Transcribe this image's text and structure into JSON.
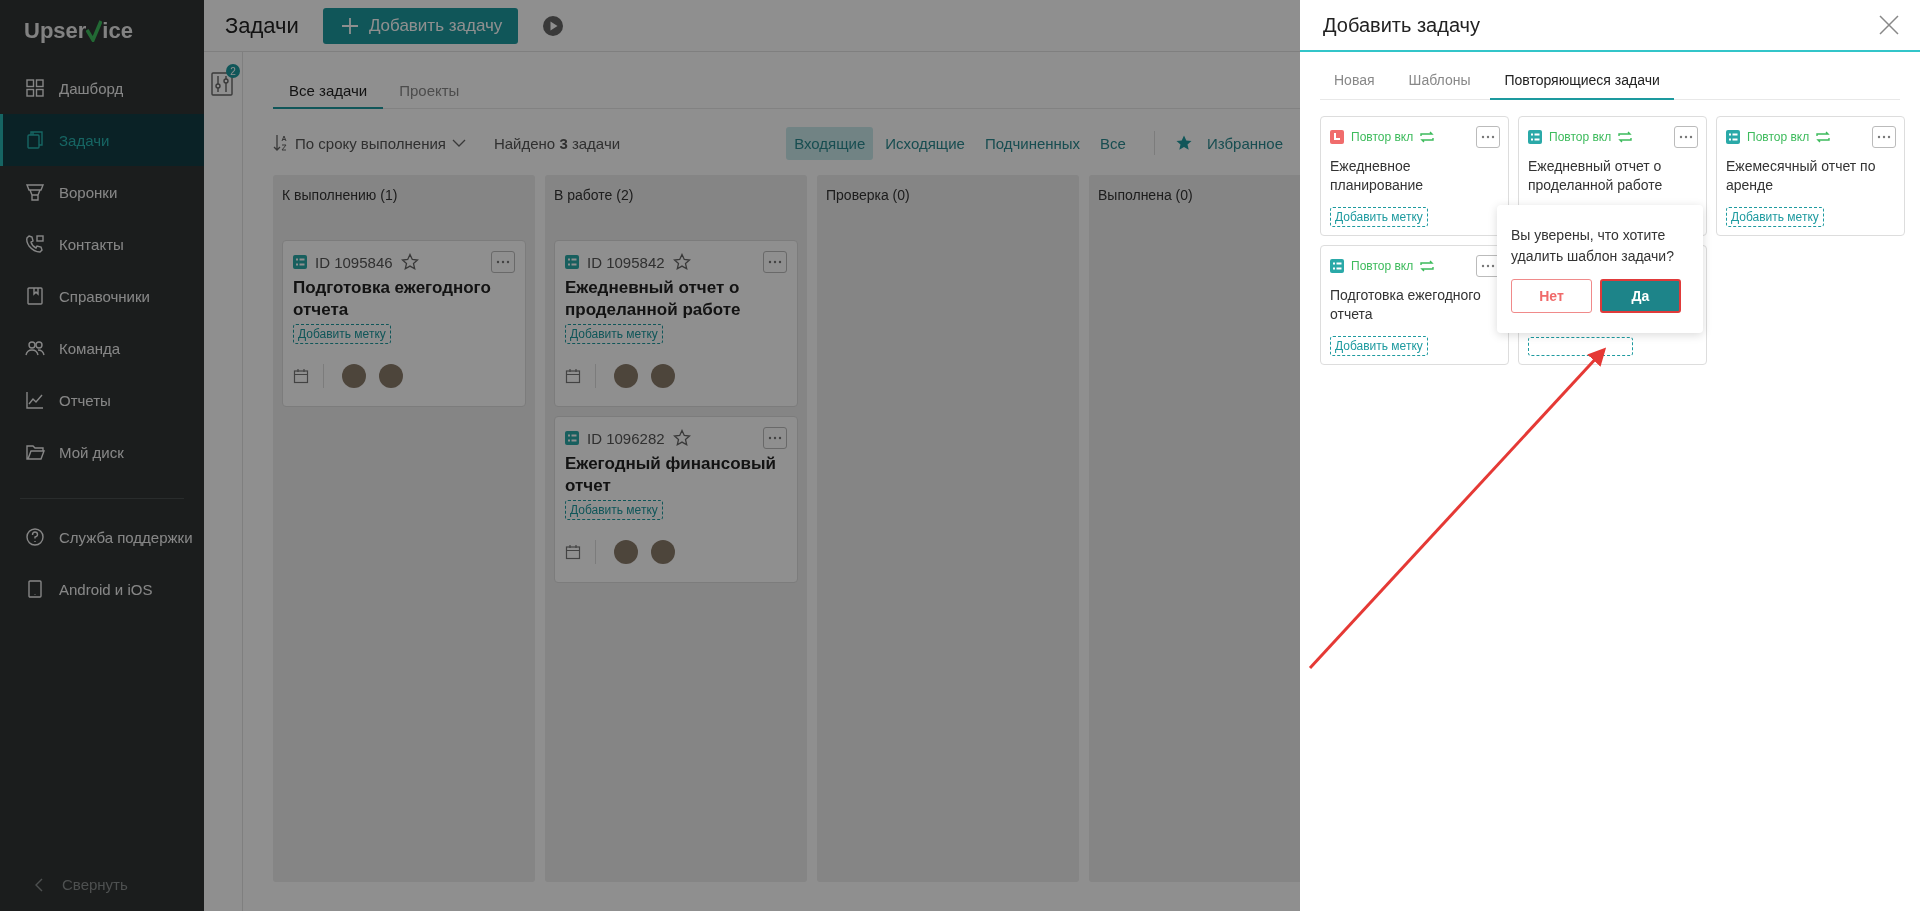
{
  "sidebar": {
    "logo": {
      "before": "Upser",
      "after": "ice"
    },
    "items": [
      {
        "label": "Дашборд",
        "selected": false
      },
      {
        "label": "Задачи",
        "selected": true
      },
      {
        "label": "Воронки",
        "selected": false
      },
      {
        "label": "Контакты",
        "selected": false
      },
      {
        "label": "Справочники",
        "selected": false
      },
      {
        "label": "Команда",
        "selected": false
      },
      {
        "label": "Отчеты",
        "selected": false
      },
      {
        "label": "Мой диск",
        "selected": false
      }
    ],
    "bottom_items": [
      {
        "label": "Служба поддержки"
      },
      {
        "label": "Android и iOS"
      }
    ],
    "collapse": "Свернуть"
  },
  "header": {
    "title": "Задачи",
    "add_button": "Добавить задачу"
  },
  "filter_badge": "2",
  "tabs": [
    {
      "label": "Все задачи",
      "selected": true
    },
    {
      "label": "Проекты",
      "selected": false
    }
  ],
  "toolbar": {
    "sort": "По сроку выполнения",
    "found": "Найдено **3** задачи",
    "filters": [
      {
        "label": "Входящие",
        "selected": true
      },
      {
        "label": "Исходящие",
        "selected": false
      },
      {
        "label": "Подчиненных",
        "selected": false
      },
      {
        "label": "Все",
        "selected": false
      }
    ],
    "favorites": "Избранное"
  },
  "columns": [
    {
      "title": "К выполнению (1)",
      "cards": [
        {
          "id": "ID 1095846",
          "title": "Подготовка ежегодного отчета",
          "tag": "Добавить метку"
        }
      ]
    },
    {
      "title": "В работе (2)",
      "cards": [
        {
          "id": "ID 1095842",
          "title": "Ежедневный отчет о проделанной работе",
          "tag": "Добавить метку"
        },
        {
          "id": "ID 1096282",
          "title": "Ежегодный финансовый отчет",
          "tag": "Добавить метку"
        }
      ]
    },
    {
      "title": "Проверка (0)"
    },
    {
      "title": "Выполнена (0)"
    }
  ],
  "panel": {
    "title": "Добавить задачу",
    "tabs": [
      {
        "label": "Новая",
        "selected": false
      },
      {
        "label": "Шаблоны",
        "selected": false
      },
      {
        "label": "Повторяющиеся задачи",
        "selected": true
      }
    ],
    "templates": [
      {
        "kind": "clock",
        "repeat": "Повтор вкл",
        "title": "Ежедневное планирование",
        "tag": "Добавить метку"
      },
      {
        "kind": "list",
        "repeat": "Повтор вкл",
        "title": "Ежедневный отчет о проделанной работе"
      },
      {
        "kind": "list",
        "repeat": "Повтор вкл",
        "title": "Ежемесячный отчет по аренде",
        "tag": "Добавить метку"
      },
      {
        "kind": "list",
        "repeat": "Повтор вкл",
        "title": "Подготовка ежегодного отчета",
        "tag": "Добавить метку"
      },
      {
        "kind": "covered"
      }
    ],
    "confirm": {
      "text": "Вы уверены, что хотите удалить шаблон задачи?",
      "no": "Нет",
      "yes": "Да"
    }
  }
}
